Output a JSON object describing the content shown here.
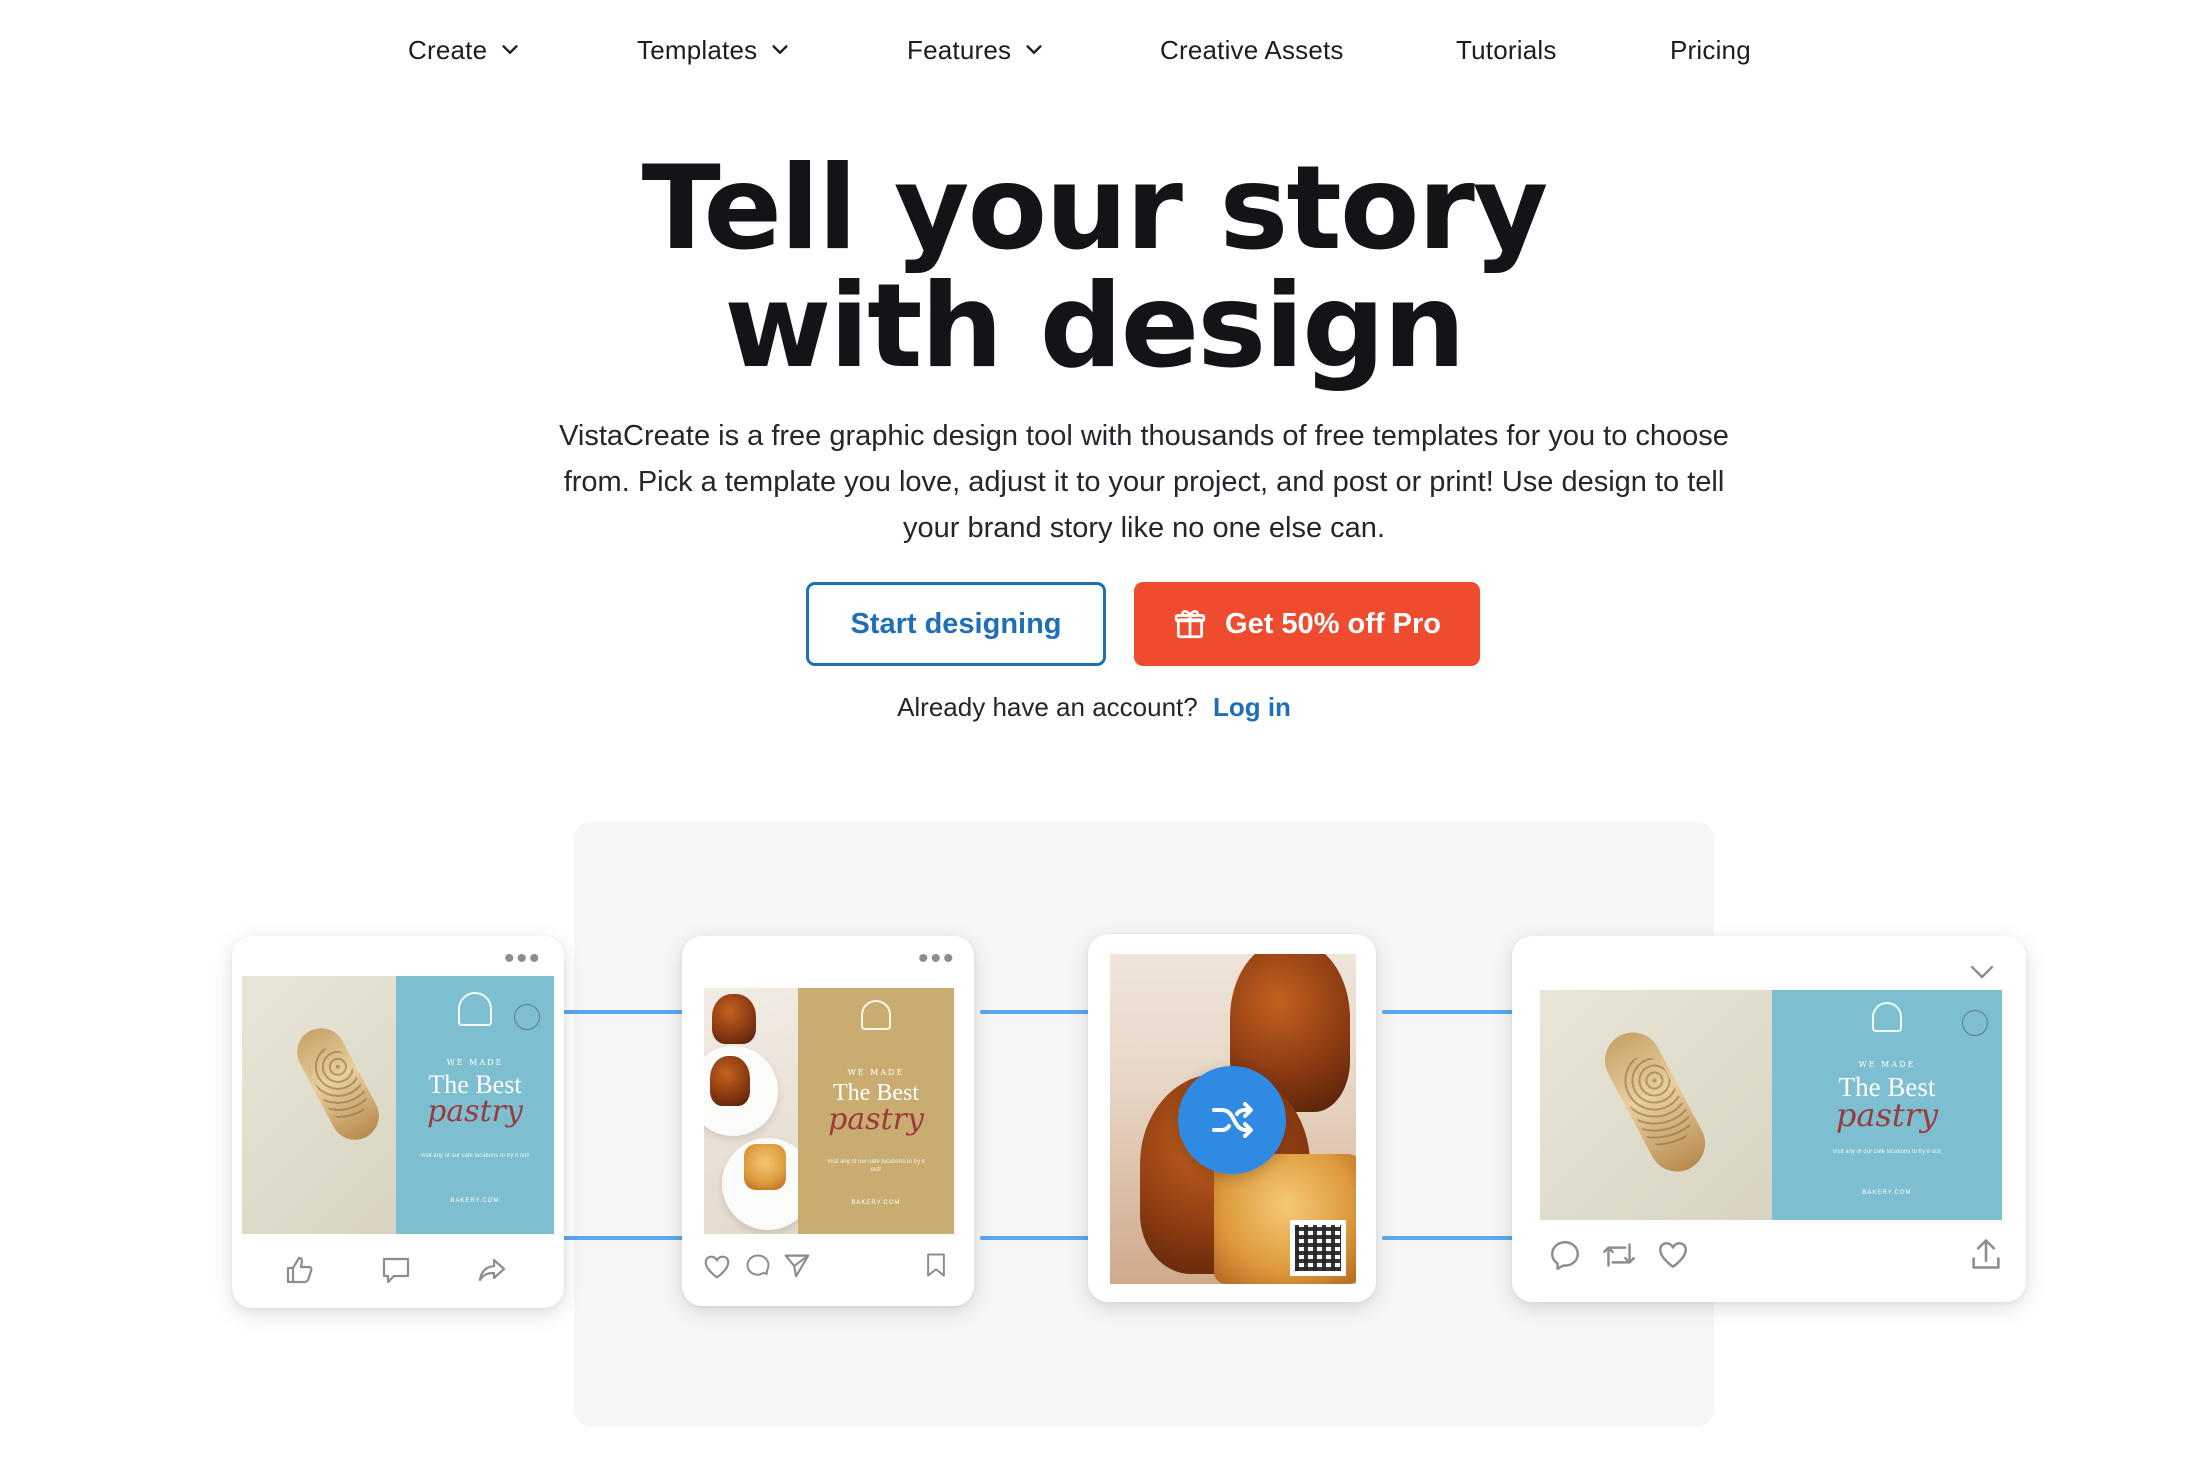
{
  "nav": {
    "items": [
      {
        "label": "Create",
        "dropdown": true
      },
      {
        "label": "Templates",
        "dropdown": true
      },
      {
        "label": "Features",
        "dropdown": true
      },
      {
        "label": "Creative Assets",
        "dropdown": false
      },
      {
        "label": "Tutorials",
        "dropdown": false
      },
      {
        "label": "Pricing",
        "dropdown": false
      }
    ]
  },
  "hero": {
    "headline_line1": "Tell your story",
    "headline_line2": "with design",
    "subtitle": "VistaCreate is a free graphic design tool with thousands of free templates for you to choose from. Pick a template you love, adjust it to your project, and post or print! Use design to tell your brand story like no one else can.",
    "start_button": "Start designing",
    "promo_button": "Get 50% off Pro",
    "account_prompt": "Already have an account?",
    "login_link": "Log in"
  },
  "template": {
    "brand": "BAKERY",
    "eyebrow": "WE MADE",
    "title": "The Best",
    "script": "pastry",
    "fine": "Visit any of our cafe locations to try it out!",
    "url": "BAKERY.COM"
  },
  "colors": {
    "accent_blue": "#1e6fb8",
    "promo_orange": "#ee4b2f",
    "teal_panel": "#7dbfd0",
    "gold_panel": "#c9ad70",
    "shuffle_blue": "#2f8ae4",
    "connector": "#5aa9ee"
  },
  "icons": {
    "card1": [
      "like-icon",
      "comment-icon",
      "share-icon"
    ],
    "card2": [
      "heart-icon",
      "comment-icon",
      "send-icon",
      "bookmark-icon"
    ],
    "card3": [
      "shuffle-icon"
    ],
    "card4": [
      "reply-icon",
      "retweet-icon",
      "heart-icon",
      "upload-icon",
      "chevron-down-icon"
    ]
  }
}
